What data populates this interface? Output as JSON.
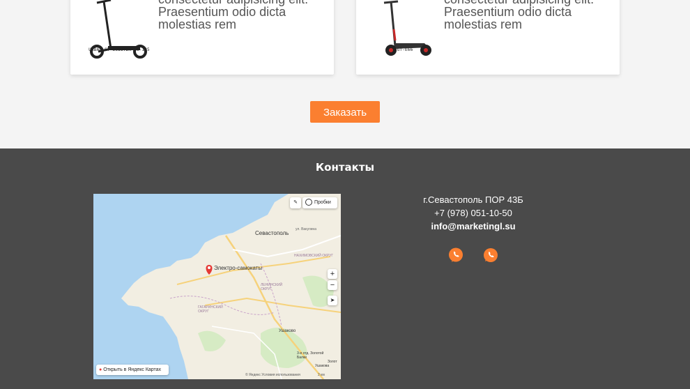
{
  "cards": [
    {
      "lines": [
        "consectetur adipisicing elit.",
        "Praesentium odio dicta",
        "molestias rem"
      ],
      "caption": "URBAN GT SCOOTER BC-125",
      "image": "scooter-black"
    },
    {
      "lines": [
        "consectetur adipisicing elit.",
        "Praesentium odio dicta",
        "molestias rem"
      ],
      "caption": "GT-E66",
      "image": "scooter-red"
    }
  ],
  "order_button": "Заказать",
  "footer": {
    "title": "Контакты",
    "address": "г.Севастополь ПОР 43Б",
    "phone": "+7 (978) 051-10-50",
    "email": "info@marketingl.su",
    "social": [
      "viber-icon",
      "whatsapp-icon"
    ],
    "accent": "#fb7f30"
  },
  "map": {
    "traffic": "Пробки",
    "city": "Севастополь",
    "street": "ул. Вакулина",
    "marker": "Электро-самокаты",
    "district1": "НАХИМОВСКИЙ ОКРУГ",
    "district2": "ЛЕНИНСКИЙ ОКРУГ",
    "district3": "ГАГАРИНСКИЙ ОКРУГ",
    "ushakovo": "Ушаково",
    "balki": "3-е отд. Золотой Балки",
    "zolotaya": "Золот",
    "ushakova2": "Ушакова",
    "open_link": "Открыть в Яндекс Картах",
    "copyright": "© Яндекс   Условия использования",
    "scale": "2 км",
    "zoom_in": "+",
    "zoom_out": "−"
  }
}
